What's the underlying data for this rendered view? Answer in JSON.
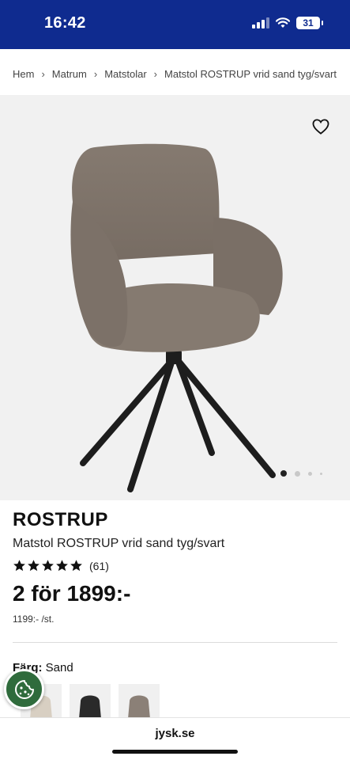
{
  "status_bar": {
    "time": "16:42",
    "battery": "31"
  },
  "breadcrumb": {
    "items": [
      "Hem",
      "Matrum",
      "Matstolar",
      "Matstol ROSTRUP vrid sand tyg/svart"
    ],
    "separator": "›"
  },
  "gallery": {
    "image_count": 4,
    "active_index": 0
  },
  "product": {
    "name": "ROSTRUP",
    "description": "Matstol ROSTRUP vrid sand tyg/svart",
    "rating_stars": 5,
    "review_count": "(61)",
    "price": "2 för 1899:-",
    "unit_price": "1199:- /st."
  },
  "color": {
    "label": "Färg:",
    "value": "Sand",
    "swatches": [
      "beige-chair",
      "black-chair",
      "sand-chair"
    ]
  },
  "browser": {
    "url": "jysk.se"
  },
  "colors": {
    "header": "#0f2b8f",
    "cookie_button": "#2f6b3c",
    "image_bg": "#f1f1f1"
  }
}
